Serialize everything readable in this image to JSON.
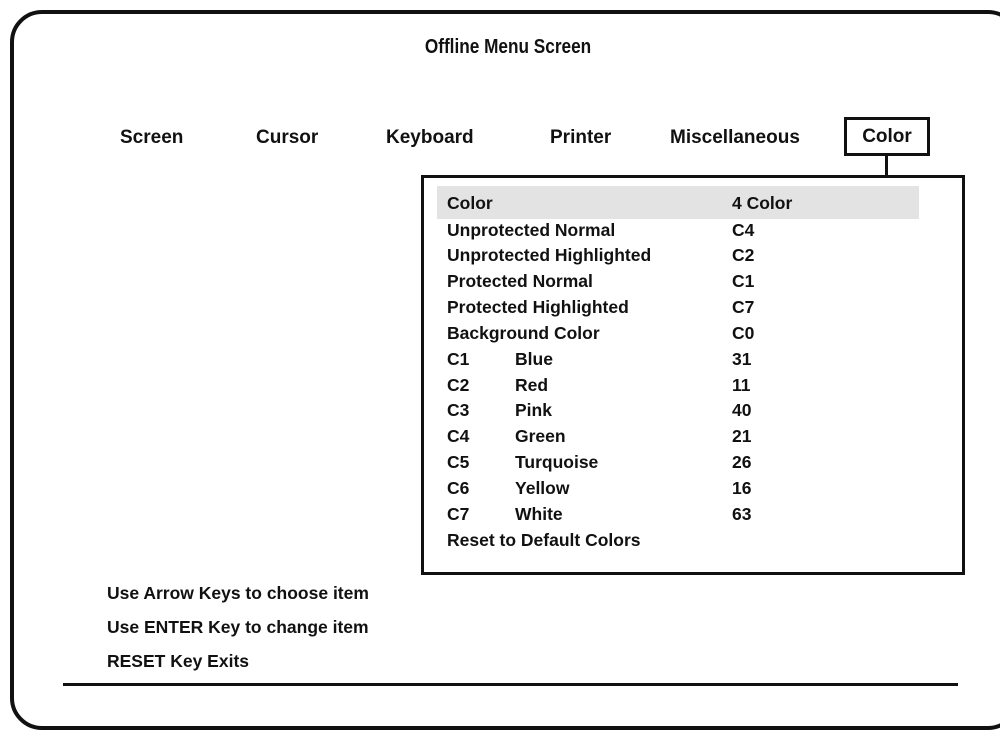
{
  "title": "Offline Menu Screen",
  "menu": {
    "tabs": [
      {
        "label": "Screen"
      },
      {
        "label": "Cursor"
      },
      {
        "label": "Keyboard"
      },
      {
        "label": "Printer"
      },
      {
        "label": "Miscellaneous"
      },
      {
        "label": "Color",
        "active": true
      }
    ]
  },
  "color_panel": {
    "items": [
      {
        "label": "Color",
        "value": "4 Color",
        "selected": true
      },
      {
        "label": "Unprotected Normal",
        "value": "C4"
      },
      {
        "label": "Unprotected Highlighted",
        "value": "C2"
      },
      {
        "label": "Protected Normal",
        "value": "C1"
      },
      {
        "label": "Protected Highlighted",
        "value": "C7"
      },
      {
        "label": "Background Color",
        "value": "C0"
      }
    ],
    "colors": [
      {
        "code": "C1",
        "name": "Blue",
        "value": "31"
      },
      {
        "code": "C2",
        "name": "Red",
        "value": "11"
      },
      {
        "code": "C3",
        "name": "Pink",
        "value": "40"
      },
      {
        "code": "C4",
        "name": "Green",
        "value": "21"
      },
      {
        "code": "C5",
        "name": "Turquoise",
        "value": "26"
      },
      {
        "code": "C6",
        "name": "Yellow",
        "value": "16"
      },
      {
        "code": "C7",
        "name": "White",
        "value": "63"
      }
    ],
    "reset_label": "Reset to Default Colors"
  },
  "help": {
    "line1": "Use Arrow Keys to choose item",
    "line2": "Use ENTER Key to change item",
    "line3": "RESET Key Exits"
  },
  "colors": {
    "ink": "#111111",
    "highlight": "#e3e3e3",
    "background": "#ffffff"
  }
}
